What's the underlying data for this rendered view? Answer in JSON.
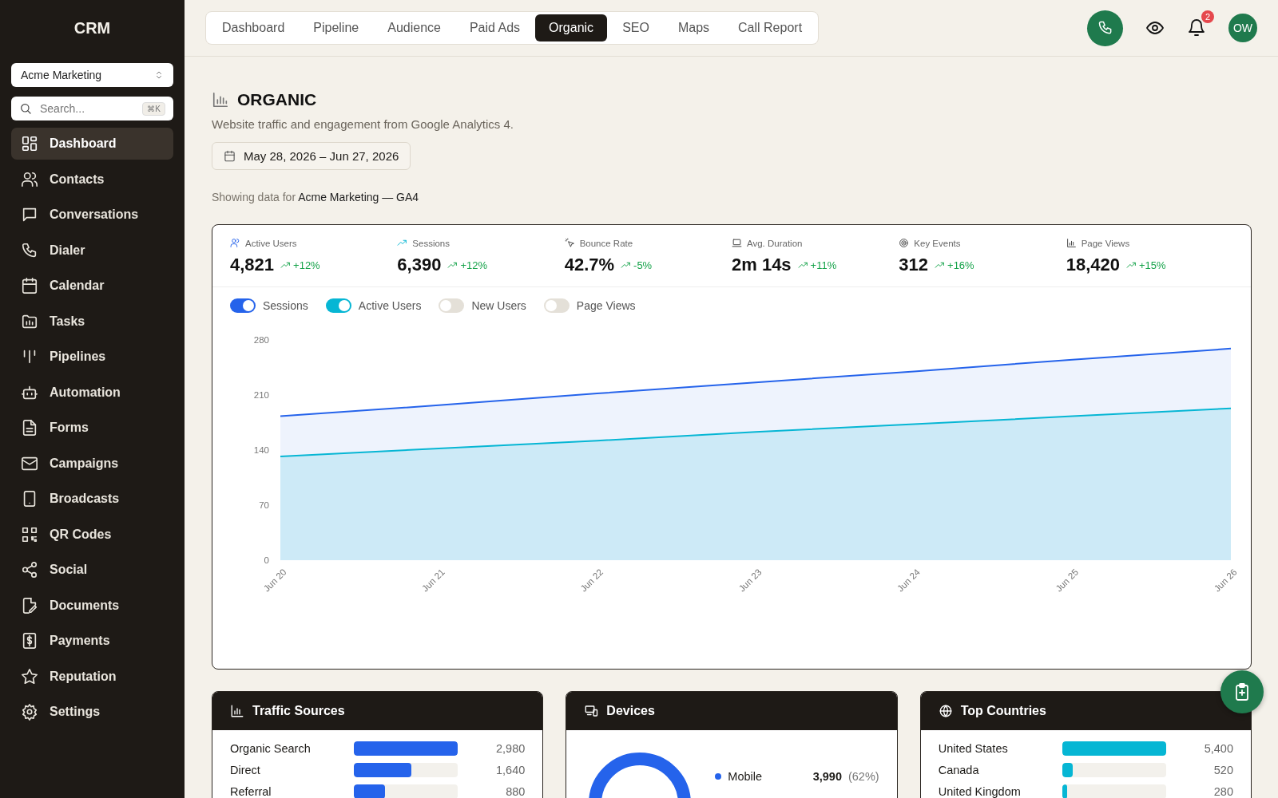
{
  "sidebar": {
    "brand": "CRM",
    "account": "Acme Marketing",
    "search": {
      "placeholder": "Search...",
      "shortcut": "⌘K"
    },
    "items": [
      {
        "label": "Dashboard",
        "selected": true
      },
      {
        "label": "Contacts",
        "selected": false
      },
      {
        "label": "Conversations",
        "selected": false
      },
      {
        "label": "Dialer",
        "selected": false
      },
      {
        "label": "Calendar",
        "selected": false
      },
      {
        "label": "Tasks",
        "selected": false
      },
      {
        "label": "Pipelines",
        "selected": false
      },
      {
        "label": "Automation",
        "selected": false
      },
      {
        "label": "Forms",
        "selected": false
      },
      {
        "label": "Campaigns",
        "selected": false
      },
      {
        "label": "Broadcasts",
        "selected": false
      },
      {
        "label": "QR Codes",
        "selected": false
      },
      {
        "label": "Social",
        "selected": false
      },
      {
        "label": "Documents",
        "selected": false
      },
      {
        "label": "Payments",
        "selected": false
      },
      {
        "label": "Reputation",
        "selected": false
      },
      {
        "label": "Settings",
        "selected": false
      }
    ]
  },
  "tabs": [
    {
      "label": "Dashboard",
      "selected": false
    },
    {
      "label": "Pipeline",
      "selected": false
    },
    {
      "label": "Audience",
      "selected": false
    },
    {
      "label": "Paid Ads",
      "selected": false
    },
    {
      "label": "Organic",
      "selected": true
    },
    {
      "label": "SEO",
      "selected": false
    },
    {
      "label": "Maps",
      "selected": false
    },
    {
      "label": "Call Report",
      "selected": false
    }
  ],
  "header_actions": {
    "notification_count": "2",
    "avatar": "OW"
  },
  "page": {
    "title": "ORGANIC",
    "subtitle": "Website traffic and engagement from Google Analytics 4.",
    "date_range": "May 28, 2026 – Jun 27, 2026",
    "showing_prefix": "Showing data for",
    "showing_source": "Acme Marketing — GA4"
  },
  "kpis": [
    {
      "label": "Active Users",
      "value": "4,821",
      "change": "+12%"
    },
    {
      "label": "Sessions",
      "value": "6,390",
      "change": "+12%"
    },
    {
      "label": "Bounce Rate",
      "value": "42.7%",
      "change": "-5%"
    },
    {
      "label": "Avg. Duration",
      "value": "2m 14s",
      "change": "+11%"
    },
    {
      "label": "Key Events",
      "value": "312",
      "change": "+16%"
    },
    {
      "label": "Page Views",
      "value": "18,420",
      "change": "+15%"
    }
  ],
  "toggles": [
    {
      "label": "New Users",
      "on": false
    },
    {
      "label": "Page Views",
      "on": false
    }
  ],
  "chart_data": {
    "type": "area",
    "categories": [
      "Jun 20",
      "Jun 21",
      "Jun 22",
      "Jun 23",
      "Jun 24",
      "Jun 25",
      "Jun 26"
    ],
    "ylim": [
      0,
      280
    ],
    "yticks": [
      0,
      70,
      140,
      210,
      280
    ],
    "series": [
      {
        "name": "Sessions",
        "color": "#2563eb",
        "values": [
          183,
          197,
          212,
          226,
          240,
          255,
          269
        ]
      },
      {
        "name": "Active Users",
        "color": "#06b6d4",
        "values": [
          132,
          142,
          152,
          163,
          173,
          183,
          193
        ]
      }
    ]
  },
  "traffic_sources": {
    "title": "Traffic Sources",
    "rows": [
      {
        "label": "Organic Search",
        "value": "2,980",
        "level": 1
      },
      {
        "label": "Direct",
        "value": "1,640",
        "level": 0.55
      },
      {
        "label": "Referral",
        "value": "880",
        "level": 0.3
      }
    ]
  },
  "devices": {
    "title": "Devices",
    "legend": [
      {
        "label": "Mobile",
        "value": "3,990",
        "share": "(62%)",
        "color": "#2563eb"
      }
    ]
  },
  "top_countries": {
    "title": "Top Countries",
    "rows": [
      {
        "label": "United States",
        "value": "5,400",
        "level": 1
      },
      {
        "label": "Canada",
        "value": "520",
        "level": 0.1
      },
      {
        "label": "United Kingdom",
        "value": "280",
        "level": 0.05
      }
    ]
  }
}
